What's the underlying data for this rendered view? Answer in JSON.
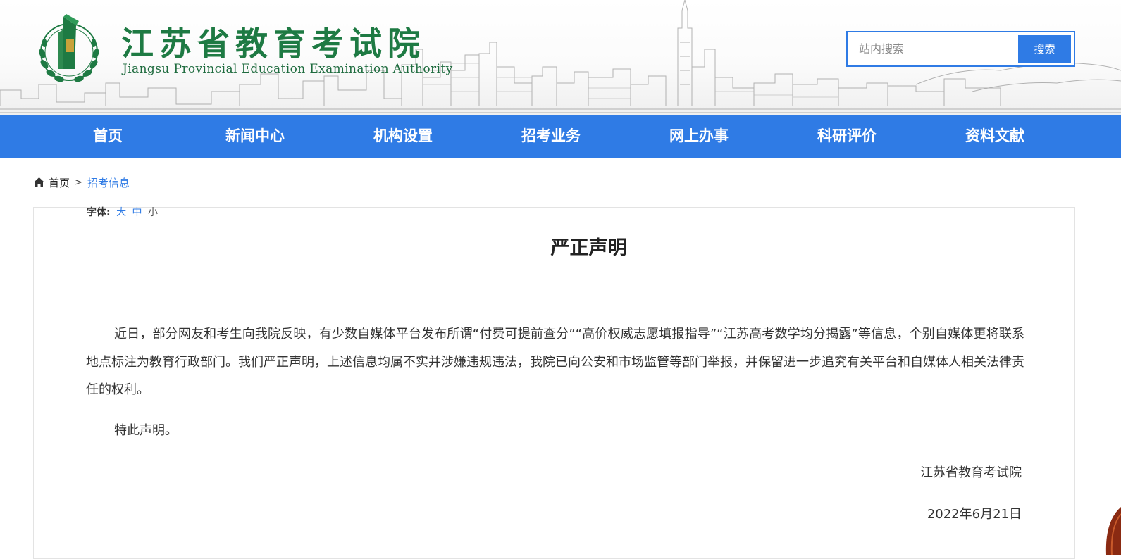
{
  "header": {
    "title": "江苏省教育考试院",
    "subtitle": "Jiangsu Provincial Education Examination Authority",
    "logo_icon": "jpeea-emblem-icon",
    "brand_color": "#1e7a43"
  },
  "search": {
    "placeholder": "站内搜索",
    "button_label": "搜索",
    "accent_color": "#2f7be5"
  },
  "nav": {
    "items": [
      {
        "label": "首页"
      },
      {
        "label": "新闻中心"
      },
      {
        "label": "机构设置"
      },
      {
        "label": "招考业务"
      },
      {
        "label": "网上办事"
      },
      {
        "label": "科研评价"
      },
      {
        "label": "资料文献"
      }
    ],
    "background_color": "#2f7be5"
  },
  "breadcrumb": {
    "home_icon": "home-icon",
    "home_label": "首页",
    "separator": ">",
    "current_label": "招考信息"
  },
  "font_size": {
    "label": "字体:",
    "options": [
      "大",
      "中",
      "小"
    ]
  },
  "article": {
    "title": "严正声明",
    "paragraph1": "近日，部分网友和考生向我院反映，有少数自媒体平台发布所谓“付费可提前查分”“高价权威志愿填报指导”“江苏高考数学均分揭露”等信息，个别自媒体更将联系地点标注为教育行政部门。我们严正声明，上述信息均属不实并涉嫌违规违法，我院已向公安和市场监管等部门举报，并保留进一步追究有关平台和自媒体人相关法律责任的权利。",
    "paragraph2": "特此声明。",
    "signature": "江苏省教育考试院",
    "date": "2022年6月21日"
  }
}
